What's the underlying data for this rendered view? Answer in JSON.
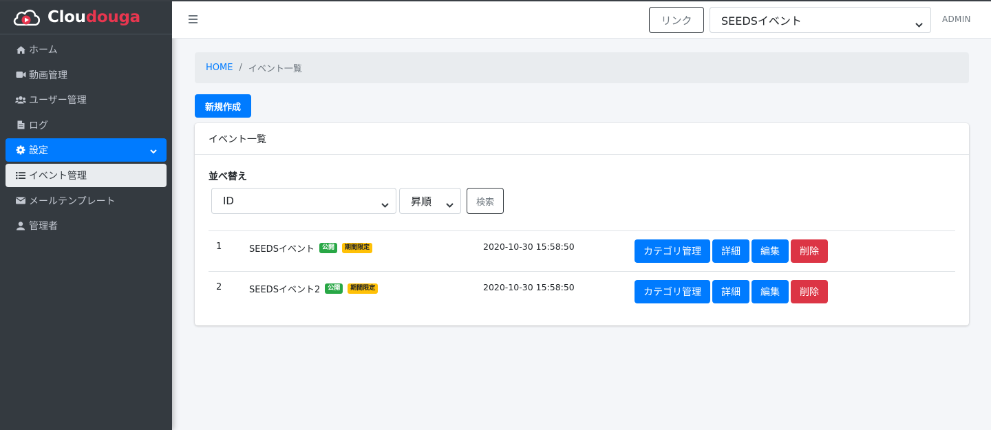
{
  "brand": {
    "name_part1": "Clou",
    "name_part2": "douga",
    "accent": "#e8364f"
  },
  "sidebar": {
    "items": [
      {
        "label": "ホーム",
        "icon": "home-icon"
      },
      {
        "label": "動画管理",
        "icon": "video-icon"
      },
      {
        "label": "ユーザー管理",
        "icon": "users-icon"
      },
      {
        "label": "ログ",
        "icon": "file-icon"
      },
      {
        "label": "設定",
        "icon": "gear-icon"
      },
      {
        "label": "イベント管理",
        "icon": "list-icon"
      },
      {
        "label": "メールテンプレート",
        "icon": "envelope-icon"
      },
      {
        "label": "管理者",
        "icon": "user-icon"
      }
    ]
  },
  "topbar": {
    "link_label": "リンク",
    "event_selected": "SEEDSイベント",
    "user": "ADMIN"
  },
  "breadcrumb": {
    "home": "HOME",
    "separator": "/",
    "current": "イベント一覧"
  },
  "new_button": "新規作成",
  "card": {
    "title": "イベント一覧",
    "sort_label": "並べ替え",
    "sort_field": "ID",
    "sort_order": "昇順",
    "search_label": "検索"
  },
  "rows": [
    {
      "id": "1",
      "name": "SEEDSイベント",
      "badge_public": "公開",
      "badge_limited": "期間限定",
      "date": "2020-10-30 15:58:50"
    },
    {
      "id": "2",
      "name": "SEEDSイベント2",
      "badge_public": "公開",
      "badge_limited": "期間限定",
      "date": "2020-10-30 15:58:50"
    }
  ],
  "actions": {
    "category": "カテゴリ管理",
    "detail": "詳細",
    "edit": "編集",
    "delete": "削除"
  },
  "colors": {
    "primary": "#007bff",
    "danger": "#dc3545",
    "success": "#28a745",
    "warning": "#ffc107",
    "sidebar": "#343a40"
  }
}
